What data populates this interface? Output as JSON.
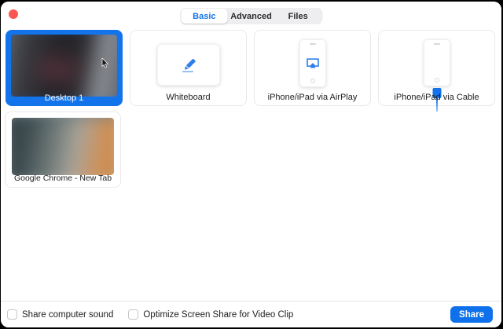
{
  "window": {
    "close_button_color": "#fb5650",
    "tabs": [
      {
        "label": "Basic",
        "selected": true
      },
      {
        "label": "Advanced",
        "selected": false
      },
      {
        "label": "Files",
        "selected": false
      }
    ]
  },
  "share_options": {
    "desktop": {
      "label": "Desktop 1",
      "selected": true,
      "type": "screen-thumbnail"
    },
    "whiteboard": {
      "label": "Whiteboard",
      "selected": false,
      "type": "whiteboard",
      "icon": "pencil-icon"
    },
    "airplay": {
      "label": "iPhone/iPad via AirPlay",
      "selected": false,
      "type": "airplay",
      "icon": "iphone-airplay-icon"
    },
    "cable": {
      "label": "iPhone/iPad via Cable",
      "selected": false,
      "type": "cable",
      "icon": "iphone-cable-icon"
    },
    "chrome": {
      "label": "Google Chrome - New Tab",
      "selected": false,
      "type": "window-thumbnail"
    }
  },
  "footer": {
    "checkboxes": [
      {
        "label": "Share computer sound",
        "checked": false
      },
      {
        "label": "Optimize Screen Share for Video Clip",
        "checked": false
      }
    ],
    "share_button": "Share"
  },
  "colors": {
    "accent_blue": "#0e71eb",
    "selected_tile_blue": "#1273eb",
    "tab_selected_text": "#1374ea",
    "close_red": "#fb5650"
  }
}
